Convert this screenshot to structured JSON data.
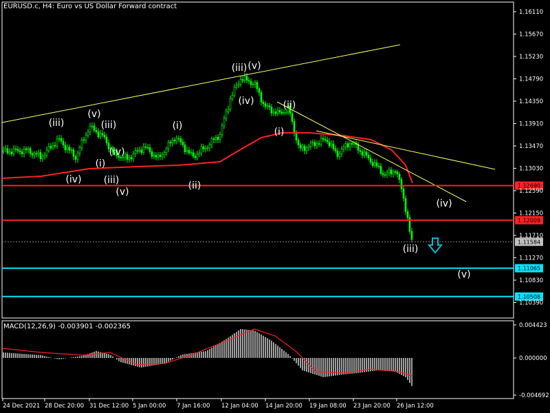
{
  "header": {
    "symbol": "EURUSD.c, H4:",
    "description": "Euro vs US Dollar Forward contract"
  },
  "price_axis": {
    "ticks": [
      "1.16110",
      "1.15670",
      "1.15230",
      "1.14790",
      "1.14350",
      "1.13910",
      "1.13470",
      "1.13030",
      "1.12590",
      "1.12150",
      "1.11710",
      "1.11270",
      "1.10830",
      "1.10390"
    ]
  },
  "levels": [
    {
      "label": "1.12690",
      "value": 1.1269,
      "color": "#ff2020",
      "type": "resistance"
    },
    {
      "label": "1.12009",
      "value": 1.12009,
      "color": "#ff2020",
      "type": "resistance"
    },
    {
      "label": "1.11065",
      "value": 1.11065,
      "color": "#00e5ff",
      "type": "support"
    },
    {
      "label": "1.10508",
      "value": 1.10508,
      "color": "#00e5ff",
      "type": "support"
    }
  ],
  "current_price": {
    "label": "1.11584",
    "value": 1.11584
  },
  "time_axis": {
    "labels": [
      "24 Dec 2021",
      "28 Dec 20:00",
      "31 Dec 12:00",
      "5 Jan 00:00",
      "7 Jan 16:00",
      "12 Jan 04:00",
      "14 Jan 20:00",
      "19 Jan 08:00",
      "23 Jan 20:00",
      "26 Jan 12:00"
    ]
  },
  "macd": {
    "title": "MACD(12,26,9) -0.003901 -0.002365",
    "axis": [
      "0.004423",
      "0.000000",
      "-0.004692"
    ]
  },
  "wave_labels": [
    "(iii)",
    "(v)",
    "(iii)",
    "(i)",
    "(iv)",
    "(iv)",
    "(iii)",
    "(v)",
    "(i)",
    "(ii)",
    "(iii)",
    "(v)",
    "(iv)",
    "(ii)",
    "(i)",
    "(iv)",
    "(iii)",
    "(v)"
  ],
  "arrow": {
    "direction": "down",
    "color": "#00bcd4"
  },
  "colors": {
    "candle": "#00ff00",
    "ma": "#ff2020",
    "trendline": "#ffff66",
    "macd_hist": "#c8c8c8",
    "macd_signal": "#ff2020"
  }
}
